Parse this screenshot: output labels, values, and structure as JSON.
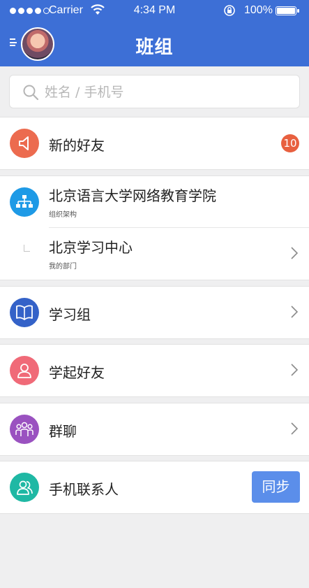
{
  "status_bar": {
    "carrier": "Carrier",
    "time": "4:34 PM",
    "battery_pct": "100%"
  },
  "header": {
    "title": "班组"
  },
  "search": {
    "placeholder": "姓名 / 手机号"
  },
  "rows": {
    "new_friends": {
      "label": "新的好友",
      "badge": "10",
      "icon": "speaker-icon",
      "color": "#ec6b4f"
    },
    "organization": {
      "label": "北京语言大学网络教育学院",
      "sub": "组织架构",
      "icon": "org-chart-icon",
      "color": "#1e9ae6"
    },
    "department": {
      "label": "北京学习中心",
      "sub": "我的部门"
    },
    "study_group": {
      "label": "学习组",
      "icon": "book-icon",
      "color": "#3462c8"
    },
    "study_friends": {
      "label": "学起好友",
      "icon": "person-icon",
      "color": "#f06a78"
    },
    "group_chat": {
      "label": "群聊",
      "icon": "group-icon",
      "color": "#9a52c0"
    },
    "phone_contacts": {
      "label": "手机联系人",
      "icon": "contacts-icon",
      "color": "#1fb8a4",
      "button": "同步"
    }
  },
  "colors": {
    "header_bg": "#3d6fd6",
    "sync_button": "#5b8eea",
    "badge": "#e8603f"
  }
}
